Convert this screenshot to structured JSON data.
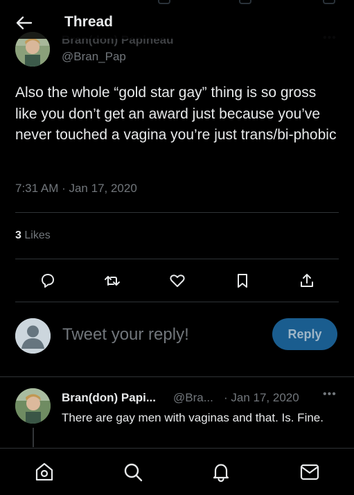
{
  "header": {
    "title": "Thread"
  },
  "author": {
    "name": "Bran(don) Papineau",
    "handle": "@Bran_Pap"
  },
  "tweet": {
    "text": "Also the whole “gold star gay” thing is so gross like you don’t get an award just because you’ve never touched a vagina you’re just trans/bi-phobic",
    "timestamp": "7:31 AM · Jan 17, 2020",
    "likes_count": "3",
    "likes_label": "Likes"
  },
  "actions": [
    "reply-icon",
    "retweet-icon",
    "like-icon",
    "bookmark-icon",
    "share-icon"
  ],
  "reply_box": {
    "placeholder": "Tweet your reply!",
    "button_label": "Reply"
  },
  "reply_tweet": {
    "name": "Bran(don) Papi...",
    "handle": "@Bra...",
    "date": "· Jan 17, 2020",
    "more": "•••",
    "text": "There are gay men with vaginas and that. Is. Fine."
  },
  "bottom_nav": [
    "home-icon",
    "search-icon",
    "notifications-icon",
    "messages-icon"
  ],
  "colors": {
    "background": "#000000",
    "text": "#e7e9ea",
    "muted": "#71767b",
    "divider": "#2f3336",
    "reply_button": "#1a5d8f"
  }
}
